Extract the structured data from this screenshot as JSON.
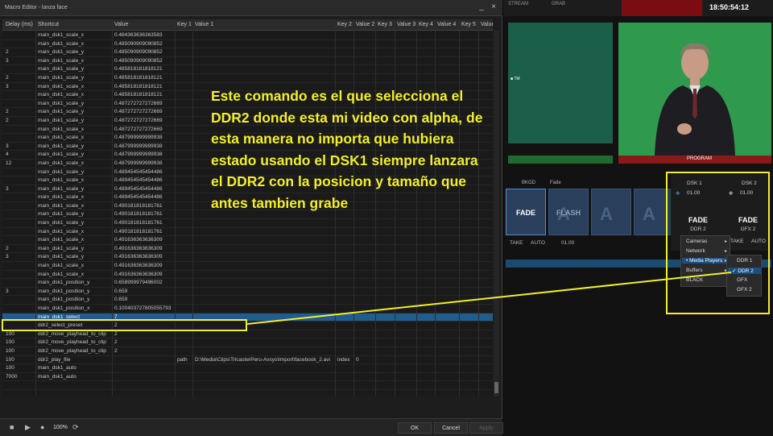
{
  "window": {
    "title": "Macro Editor - lanza face",
    "minimize": "_",
    "close": "×"
  },
  "table": {
    "headers": [
      "Delay (ms)",
      "Shortcut",
      "Value",
      "Key 1",
      "Value 1",
      "Key 2",
      "Value 2",
      "Key 3",
      "Value 3",
      "Key 4",
      "Value 4",
      "Key 5",
      "Value"
    ],
    "rows": [
      [
        "",
        "main_dsk1_scale_x",
        "0.484363636363583",
        "",
        "",
        "",
        "",
        "",
        "",
        "",
        "",
        "",
        ""
      ],
      [
        "",
        "main_dsk1_scale_x",
        "0.485090909090852",
        "",
        "",
        "",
        "",
        "",
        "",
        "",
        "",
        "",
        ""
      ],
      [
        "2",
        "main_dsk1_scale_y",
        "0.485090909090852",
        "",
        "",
        "",
        "",
        "",
        "",
        "",
        "",
        "",
        ""
      ],
      [
        "3",
        "main_dsk1_scale_x",
        "0.485090909090852",
        "",
        "",
        "",
        "",
        "",
        "",
        "",
        "",
        "",
        ""
      ],
      [
        "",
        "main_dsk1_scale_y",
        "0.485818181818121",
        "",
        "",
        "",
        "",
        "",
        "",
        "",
        "",
        "",
        ""
      ],
      [
        "2",
        "main_dsk1_scale_y",
        "0.485818181818121",
        "",
        "",
        "",
        "",
        "",
        "",
        "",
        "",
        "",
        ""
      ],
      [
        "3",
        "main_dsk1_scale_x",
        "0.485818181818121",
        "",
        "",
        "",
        "",
        "",
        "",
        "",
        "",
        "",
        ""
      ],
      [
        "",
        "main_dsk1_scale_x",
        "0.485818181818121",
        "",
        "",
        "",
        "",
        "",
        "",
        "",
        "",
        "",
        ""
      ],
      [
        "",
        "main_dsk1_scale_y",
        "0.487272727272669",
        "",
        "",
        "",
        "",
        "",
        "",
        "",
        "",
        "",
        ""
      ],
      [
        "2",
        "main_dsk1_scale_y",
        "0.487272727272669",
        "",
        "",
        "",
        "",
        "",
        "",
        "",
        "",
        "",
        ""
      ],
      [
        "2",
        "main_dsk1_scale_y",
        "0.487272727272669",
        "",
        "",
        "",
        "",
        "",
        "",
        "",
        "",
        "",
        ""
      ],
      [
        "",
        "main_dsk1_scale_x",
        "0.487272727272669",
        "",
        "",
        "",
        "",
        "",
        "",
        "",
        "",
        "",
        ""
      ],
      [
        "",
        "main_dsk1_scale_x",
        "0.487999999999938",
        "",
        "",
        "",
        "",
        "",
        "",
        "",
        "",
        "",
        ""
      ],
      [
        "3",
        "main_dsk1_scale_y",
        "0.487999999999938",
        "",
        "",
        "",
        "",
        "",
        "",
        "",
        "",
        "",
        ""
      ],
      [
        "4",
        "main_dsk1_scale_y",
        "0.487999999999938",
        "",
        "",
        "",
        "",
        "",
        "",
        "",
        "",
        "",
        ""
      ],
      [
        "12",
        "main_dsk1_scale_x",
        "0.487999999999938",
        "",
        "",
        "",
        "",
        "",
        "",
        "",
        "",
        "",
        ""
      ],
      [
        "",
        "main_dsk1_scale_y",
        "0.489454545454486",
        "",
        "",
        "",
        "",
        "",
        "",
        "",
        "",
        "",
        ""
      ],
      [
        "",
        "main_dsk1_scale_x",
        "0.489454545454486",
        "",
        "",
        "",
        "",
        "",
        "",
        "",
        "",
        "",
        ""
      ],
      [
        "3",
        "main_dsk1_scale_y",
        "0.489454545454486",
        "",
        "",
        "",
        "",
        "",
        "",
        "",
        "",
        "",
        ""
      ],
      [
        "",
        "main_dsk1_scale_x",
        "0.489454545454486",
        "",
        "",
        "",
        "",
        "",
        "",
        "",
        "",
        "",
        ""
      ],
      [
        "",
        "main_dsk1_scale_x",
        "0.490181818181761",
        "",
        "",
        "",
        "",
        "",
        "",
        "",
        "",
        "",
        ""
      ],
      [
        "",
        "main_dsk1_scale_y",
        "0.490181818181761",
        "",
        "",
        "",
        "",
        "",
        "",
        "",
        "",
        "",
        ""
      ],
      [
        "",
        "main_dsk1_scale_y",
        "0.490181818181761",
        "",
        "",
        "",
        "",
        "",
        "",
        "",
        "",
        "",
        ""
      ],
      [
        "",
        "main_dsk1_scale_x",
        "0.490181818181761",
        "",
        "",
        "",
        "",
        "",
        "",
        "",
        "",
        "",
        ""
      ],
      [
        "",
        "main_dsk1_scale_x",
        "0.491636363636309",
        "",
        "",
        "",
        "",
        "",
        "",
        "",
        "",
        "",
        ""
      ],
      [
        "2",
        "main_dsk1_scale_y",
        "0.491636363636309",
        "",
        "",
        "",
        "",
        "",
        "",
        "",
        "",
        "",
        ""
      ],
      [
        "3",
        "main_dsk1_scale_y",
        "0.491636363636309",
        "",
        "",
        "",
        "",
        "",
        "",
        "",
        "",
        "",
        ""
      ],
      [
        "",
        "main_dsk1_scale_x",
        "0.491636363636309",
        "",
        "",
        "",
        "",
        "",
        "",
        "",
        "",
        "",
        ""
      ],
      [
        "",
        "main_dsk1_scale_x",
        "0.491636363636309",
        "",
        "",
        "",
        "",
        "",
        "",
        "",
        "",
        "",
        ""
      ],
      [
        "",
        "main_dsk1_position_y",
        "0.658999979496002",
        "",
        "",
        "",
        "",
        "",
        "",
        "",
        "",
        "",
        ""
      ],
      [
        "3",
        "main_dsk1_position_y",
        "0.659",
        "",
        "",
        "",
        "",
        "",
        "",
        "",
        "",
        "",
        ""
      ],
      [
        "",
        "main_dsk1_position_y",
        "0.659",
        "",
        "",
        "",
        "",
        "",
        "",
        "",
        "",
        "",
        ""
      ],
      [
        "",
        "main_dsk1_position_x",
        "0.100403727805055793",
        "",
        "",
        "",
        "",
        "",
        "",
        "",
        "",
        "",
        ""
      ],
      [
        "",
        "main_dsk1_select",
        "7",
        "",
        "",
        "",
        "",
        "",
        "",
        "",
        "",
        "",
        ""
      ],
      [
        "",
        "ddr2_select_preset",
        "2",
        "",
        "",
        "",
        "",
        "",
        "",
        "",
        "",
        "",
        ""
      ],
      [
        "100",
        "ddr2_move_playhead_to_clip",
        "2",
        "",
        "",
        "",
        "",
        "",
        "",
        "",
        "",
        "",
        ""
      ],
      [
        "100",
        "ddr2_move_playhead_to_clip",
        "2",
        "",
        "",
        "",
        "",
        "",
        "",
        "",
        "",
        "",
        ""
      ],
      [
        "100",
        "ddr2_move_playhead_to_clip",
        "2",
        "",
        "",
        "",
        "",
        "",
        "",
        "",
        "",
        "",
        ""
      ],
      [
        "100",
        "ddr2_play_file",
        "",
        "path",
        "D:\\Media\\Clips\\TricasterPeru-Avsys\\Import\\facebook_2.avi",
        "index",
        "0",
        "",
        "",
        "",
        "",
        "",
        ""
      ],
      [
        "100",
        "main_dsk1_auto",
        "",
        "",
        "",
        "",
        "",
        "",
        "",
        "",
        "",
        "",
        ""
      ],
      [
        "7000",
        "main_dsk1_auto",
        "",
        "",
        "",
        "",
        "",
        "",
        "",
        "",
        "",
        "",
        ""
      ],
      [
        "",
        "",
        "",
        "",
        "",
        "",
        "",
        "",
        "",
        "",
        "",
        "",
        ""
      ],
      [
        "",
        "",
        "",
        "",
        "",
        "",
        "",
        "",
        "",
        "",
        "",
        "",
        ""
      ],
      [
        "",
        "",
        "",
        "",
        "",
        "",
        "",
        "",
        "",
        "",
        "",
        "",
        ""
      ]
    ],
    "selected_row": 33
  },
  "bottom_bar": {
    "zoom": "100%",
    "ok_label": "OK",
    "cancel_label": "Cancel",
    "apply_label": "Apply"
  },
  "tricaster": {
    "top_label_1": "STREAM",
    "top_label_2": "GRAB",
    "timecode": "18:50:54:12",
    "preview_tag": "■ TM",
    "program_label": "PROGRAM",
    "bkgd_label": "BKGD",
    "fade_label": "Fade",
    "thumb_fade": "FADE",
    "thumb_flash": "FLASH",
    "take_label": "TAKE",
    "auto_label": "AUTO",
    "transition_duration": "01.00",
    "dsk1_label": "DSK 1",
    "dsk2_label": "DSK 2",
    "dsk1_duration": "01.00",
    "dsk2_duration": "01.00",
    "dsk1_fade": "FADE",
    "dsk2_fade": "FADE",
    "dsk1_source": "DDR 2",
    "dsk2_source": "GFX 2",
    "dsk_take": "TAKE",
    "dsk_auto": "AUTO",
    "menu": {
      "items": [
        "Cameras",
        "Network",
        "Media Players",
        "Buffers",
        "BLACK"
      ],
      "submenu": [
        "DDR 1",
        "DDR 2",
        "GFX",
        "GFX 2"
      ],
      "active_item": "Media Players",
      "active_sub": "DDR 2"
    }
  },
  "annotation": {
    "text": "Este comando es el que selecciona el DDR2 donde esta mi video con alpha, de esta manera no importa que hubiera estado usando el DSK1 siempre lanzara el DDR2 con la posicion y tamaño que antes tambien grabe",
    "color": "#f2ee2c"
  }
}
